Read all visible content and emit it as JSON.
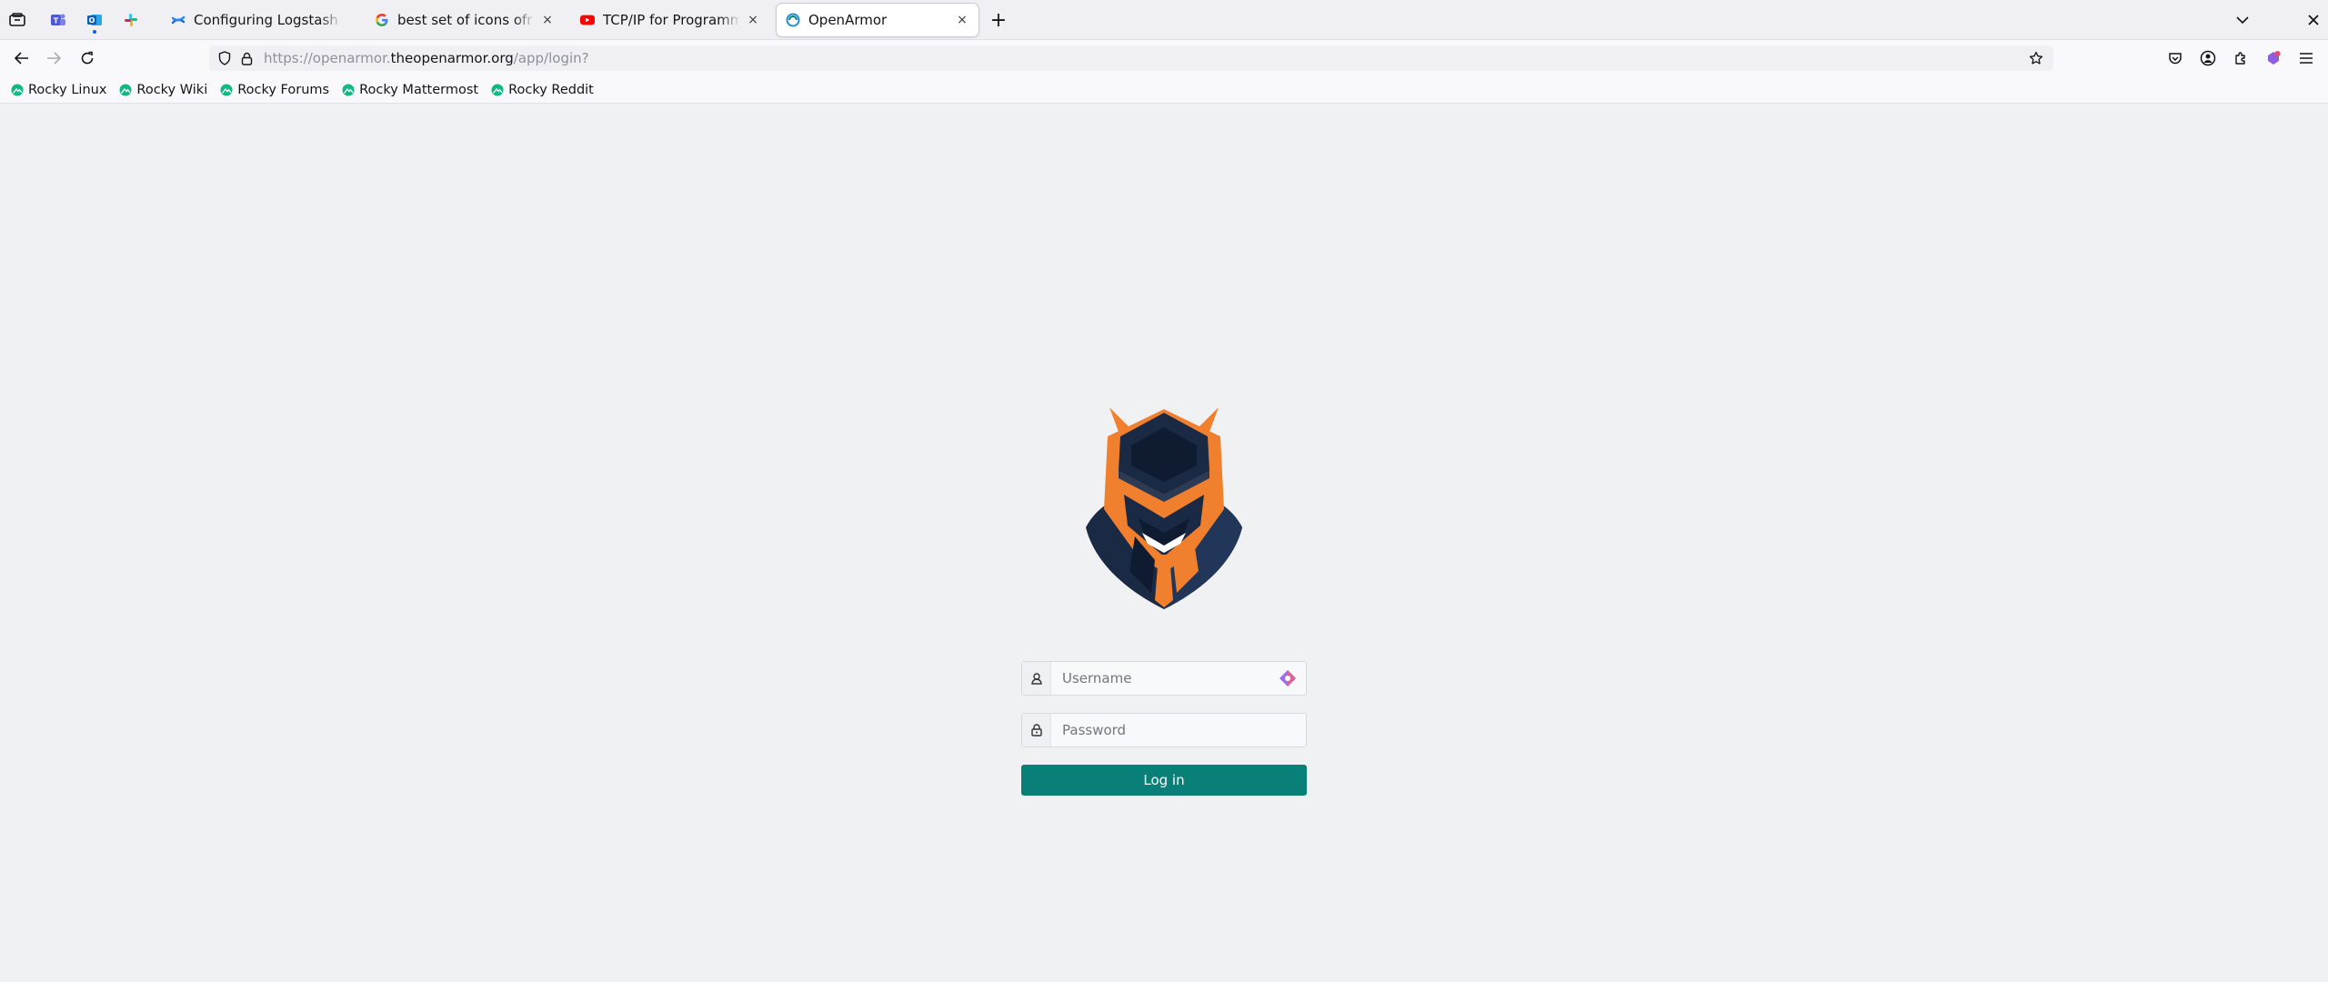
{
  "browser": {
    "pinned_tabs": [
      {
        "name": "pinned-tab-teams",
        "icon": "teams-icon"
      },
      {
        "name": "pinned-tab-outlook",
        "icon": "outlook-icon"
      },
      {
        "name": "pinned-tab-slack",
        "icon": "slack-icon"
      }
    ],
    "tabs": [
      {
        "title": "Configuring Logstash on Docker",
        "favicon": "confluence-icon"
      },
      {
        "title": "best set of icons ofr gnome",
        "favicon": "google-icon"
      },
      {
        "title": "TCP/IP for Programmers",
        "favicon": "youtube-icon"
      },
      {
        "title": "OpenArmor",
        "favicon": "openarmor-icon",
        "active": true
      }
    ],
    "new_tab_label": "+",
    "close_glyph": "×"
  },
  "navbar": {
    "url_prefix": "https://openarmor.",
    "url_domain": "theopenarmor.org",
    "url_path": "/app/login?"
  },
  "bookmarks": [
    {
      "label": "Rocky Linux"
    },
    {
      "label": "Rocky Wiki"
    },
    {
      "label": "Rocky Forums"
    },
    {
      "label": "Rocky Mattermost"
    },
    {
      "label": "Rocky Reddit"
    }
  ],
  "login": {
    "username_placeholder": "Username",
    "password_placeholder": "Password",
    "submit_label": "Log in"
  },
  "colors": {
    "accent": "#0a7f78",
    "logo_orange": "#f07f2e",
    "logo_navy": "#1a2a44"
  }
}
